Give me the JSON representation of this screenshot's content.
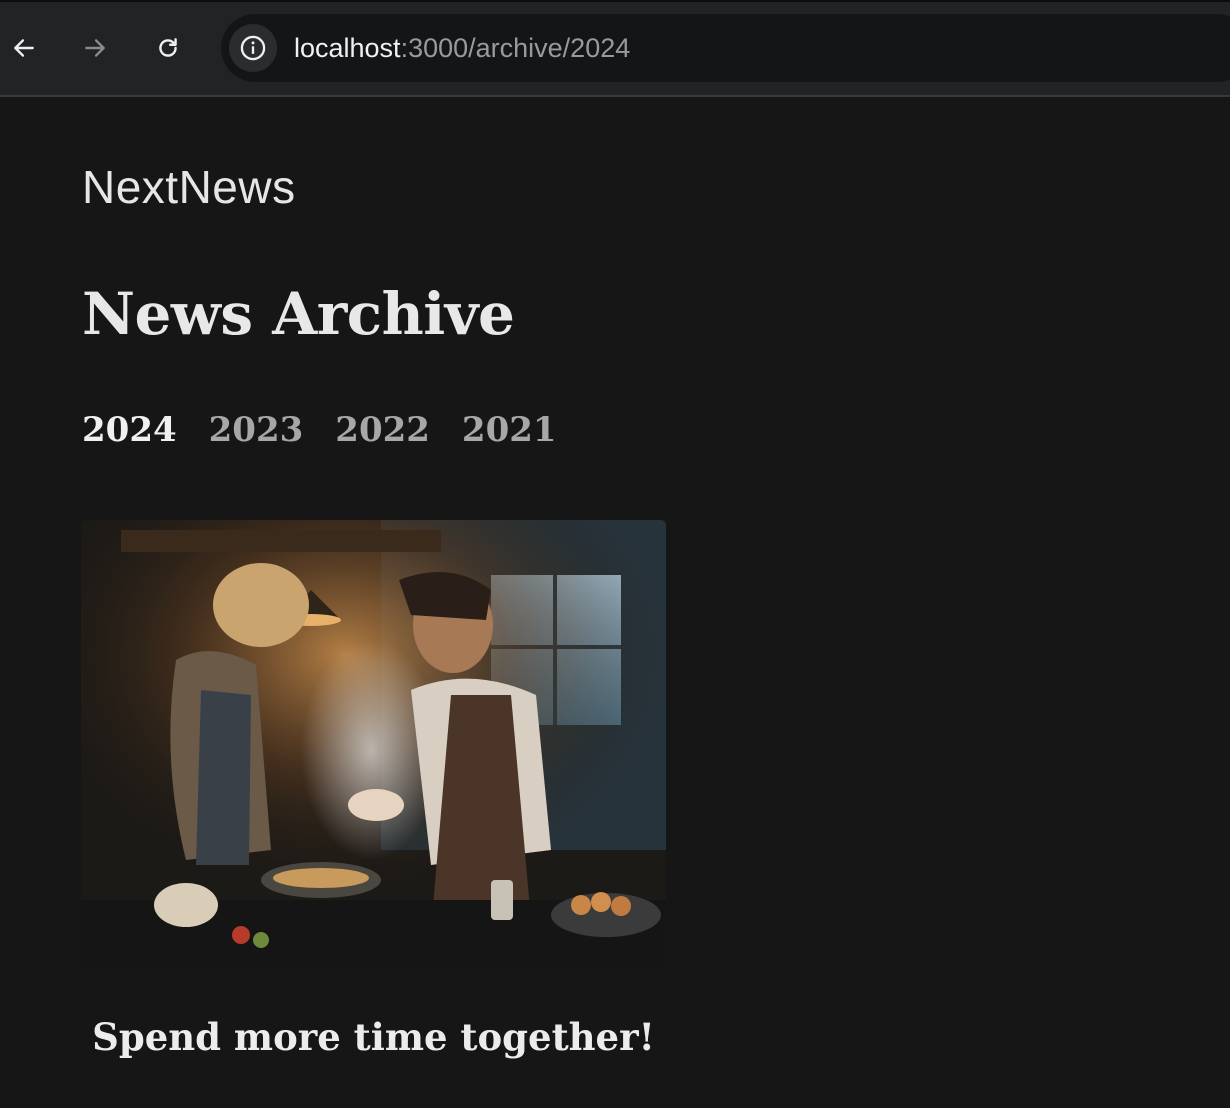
{
  "browser": {
    "url_host": "localhost",
    "url_path": ":3000/archive/2024"
  },
  "site": {
    "brand": "NextNews"
  },
  "page": {
    "title": "News Archive"
  },
  "years": [
    {
      "label": "2024",
      "active": true
    },
    {
      "label": "2023",
      "active": false
    },
    {
      "label": "2022",
      "active": false
    },
    {
      "label": "2021",
      "active": false
    }
  ],
  "news": [
    {
      "title": "Spend more time together!"
    }
  ],
  "colors": {
    "background": "#161616",
    "text": "#e6e6e6",
    "year_inactive": "#a7a7a7"
  }
}
